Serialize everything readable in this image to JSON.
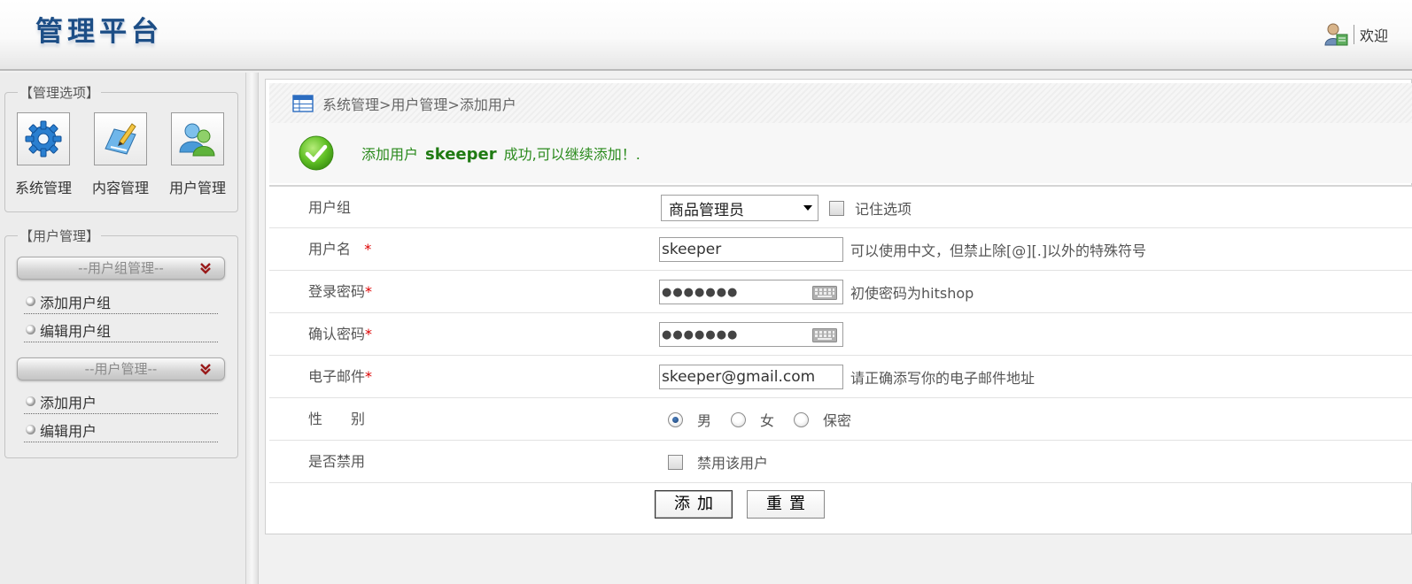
{
  "header": {
    "logo_text": "管理平台",
    "welcome_text": "欢迎"
  },
  "sidebar": {
    "manage_options_title": "【管理选项】",
    "tiles": [
      {
        "label": "系统管理",
        "icon": "gear-icon"
      },
      {
        "label": "内容管理",
        "icon": "pencil-icon"
      },
      {
        "label": "用户管理",
        "icon": "users-icon"
      }
    ],
    "user_manage_title": "【用户管理】",
    "groups": [
      {
        "label": "--用户组管理--",
        "items": [
          "添加用户组",
          "编辑用户组"
        ]
      },
      {
        "label": "--用户管理--",
        "items": [
          "添加用户",
          "编辑用户"
        ]
      }
    ]
  },
  "main": {
    "breadcrumb": "系统管理>用户管理>添加用户",
    "success": {
      "prefix": "添加用户",
      "username": "skeeper",
      "suffix": "成功,可以继续添加！."
    },
    "form": {
      "group_label": "用户组",
      "group_value": "商品管理员",
      "remember_label": "记住选项",
      "username_label": "用户名",
      "username_value": "skeeper",
      "username_hint": "可以使用中文，但禁止除[@][.]以外的特殊符号",
      "password_label": "登录密码",
      "password_value": "●●●●●●●",
      "password_hint": "初使密码为hitshop",
      "confirm_label": "确认密码",
      "confirm_value": "●●●●●●●",
      "email_label": "电子邮件",
      "email_value": "skeeper@gmail.com",
      "email_hint": "请正确添写你的电子邮件地址",
      "gender_label": "性　　别",
      "gender_options": [
        "男",
        "女",
        "保密"
      ],
      "gender_selected": "男",
      "disable_label": "是否禁用",
      "disable_option": "禁用该用户",
      "required_mark": "*"
    },
    "buttons": {
      "add": "添加",
      "reset": "重置"
    }
  },
  "colors": {
    "logo": "#1d4e86",
    "success_text": "#2a8a1c",
    "required": "#dd0000"
  }
}
